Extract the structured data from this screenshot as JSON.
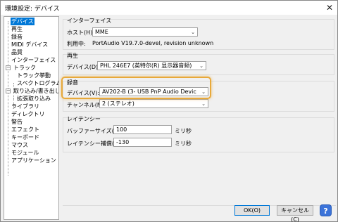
{
  "window": {
    "title": "環境設定: デバイス",
    "close_glyph": "✕"
  },
  "tree": {
    "items": [
      {
        "label": "デバイス"
      },
      {
        "label": "再生"
      },
      {
        "label": "録音"
      },
      {
        "label": "MIDI デバイス"
      },
      {
        "label": "品質"
      },
      {
        "label": "インターフェイス"
      },
      {
        "label": "トラック"
      },
      {
        "label": "トラック挙動"
      },
      {
        "label": "スペクトログラム"
      },
      {
        "label": "取り込み/書き出し"
      },
      {
        "label": "拡張取り込み"
      },
      {
        "label": "ライブラリ"
      },
      {
        "label": "ディレクトリ"
      },
      {
        "label": "警告"
      },
      {
        "label": "エフェクト"
      },
      {
        "label": "キーボード"
      },
      {
        "label": "マウス"
      },
      {
        "label": "モジュール"
      },
      {
        "label": "アプリケーション"
      }
    ],
    "expander_glyph": "−"
  },
  "interface": {
    "title": "インターフェイス",
    "host_label": "ホスト(H):",
    "host_value": "MME",
    "using_label": "利用中:",
    "using_value": "PortAudio V19.7.0-devel, revision unknown"
  },
  "playback": {
    "title": "再生",
    "device_label": "デバイス(D):",
    "device_value": "PHL 246E7 (英特尔(R) 显示器音频)"
  },
  "recording": {
    "title": "録音",
    "device_label": "デバイス(V):",
    "device_value": "AV202-B (3- USB PnP Audio Devic",
    "channels_label": "チャンネル(N):",
    "channels_value": "2 (ステレオ)"
  },
  "latency": {
    "title": "レイテンシー",
    "buffer_label": "バッファーサイズ(B):",
    "buffer_value": "100",
    "buffer_unit": "ミリ秒",
    "comp_label": "レイテンシー補償(L):",
    "comp_value": "-130",
    "comp_unit": "ミリ秒"
  },
  "buttons": {
    "ok": "OK(O)",
    "cancel": "キャンセル(C)",
    "help": "?"
  },
  "combo_arrow": "⌄",
  "colors": {
    "selection": "#0078d7",
    "highlight": "#e8a93a",
    "help": "#3b73d9"
  }
}
